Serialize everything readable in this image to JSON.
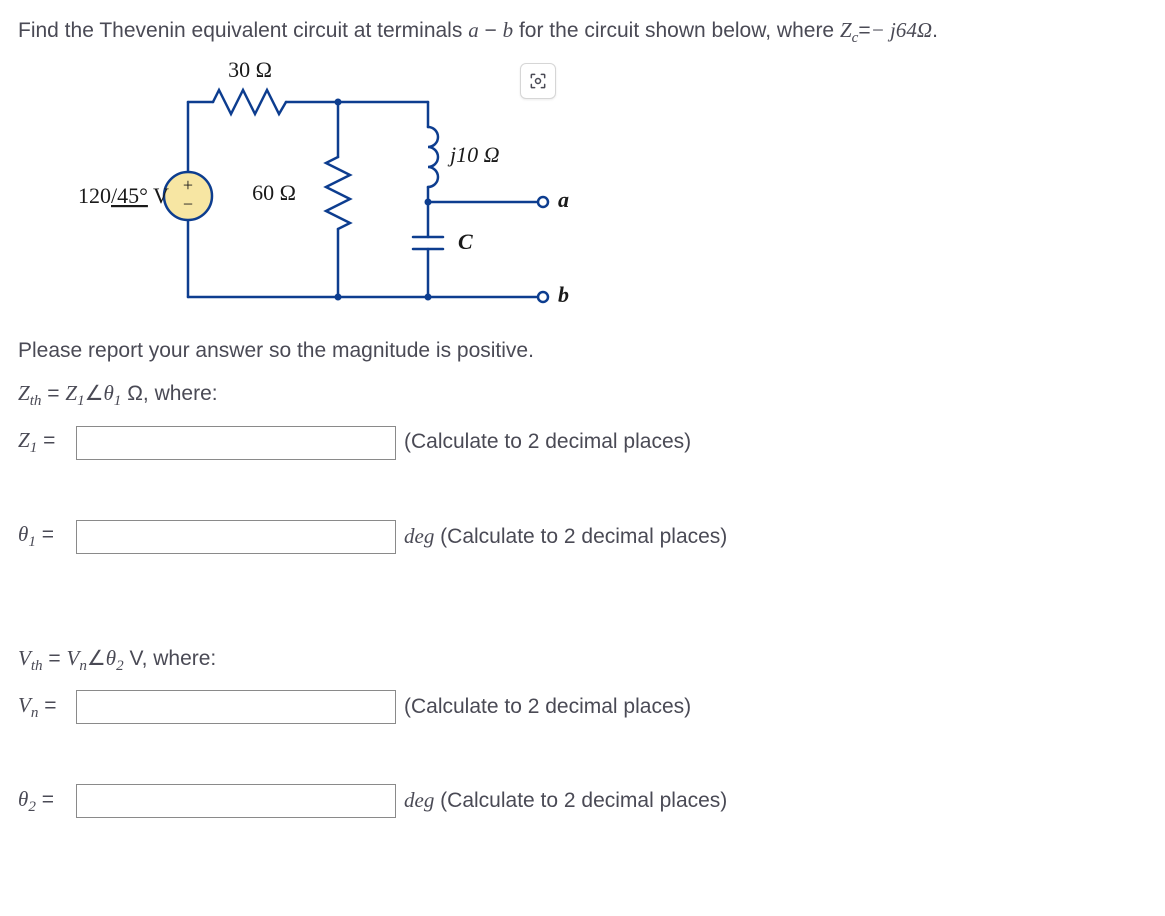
{
  "problem": {
    "prefix": "Find the Thevenin equivalent circuit at terminals ",
    "terma": "a",
    "dash": " − ",
    "termb": "b",
    "mid": " for the circuit shown below, where ",
    "zclhs": "Z",
    "zcsub": "c",
    "eq": "=",
    "zcval": "− j64Ω",
    "period": "."
  },
  "circuit": {
    "r1": "30 Ω",
    "r2": "60 Ω",
    "l1": "j10 Ω",
    "c_label": "C",
    "src": "120/45° V",
    "term_a": "a",
    "term_b": "b",
    "src_plus": "+",
    "src_minus": "−"
  },
  "instruction": "Please report your answer so the magnitude is positive.",
  "zth": {
    "lhs_Z": "Z",
    "lhs_sub": "th",
    "eq": " = ",
    "Zvar": "Z",
    "Zsub": "1",
    "angle": "∠",
    "theta": "θ",
    "thetasub": "1",
    "unit": " Ω",
    "where": ", where:"
  },
  "z1": {
    "label_sym": "Z",
    "label_sub": "1",
    "eq": " = ",
    "hint": "(Calculate to 2 decimal places)"
  },
  "t1": {
    "label_sym": "θ",
    "label_sub": "1",
    "eq": " = ",
    "unit": "deg",
    "hint": " (Calculate to 2 decimal places)"
  },
  "vth": {
    "lhs_V": "V",
    "lhs_sub": "th",
    "eq": " = ",
    "Vvar": "V",
    "Vsub": "n",
    "angle": "∠",
    "theta": "θ",
    "thetasub": "2",
    "unit": " V",
    "where": ", where:"
  },
  "vn": {
    "label_sym": "V",
    "label_sub": "n",
    "eq": " = ",
    "hint": "(Calculate to 2 decimal places)"
  },
  "t2": {
    "label_sym": "θ",
    "label_sub": "2",
    "eq": " = ",
    "unit": "deg",
    "hint": " (Calculate to 2 decimal places)"
  }
}
